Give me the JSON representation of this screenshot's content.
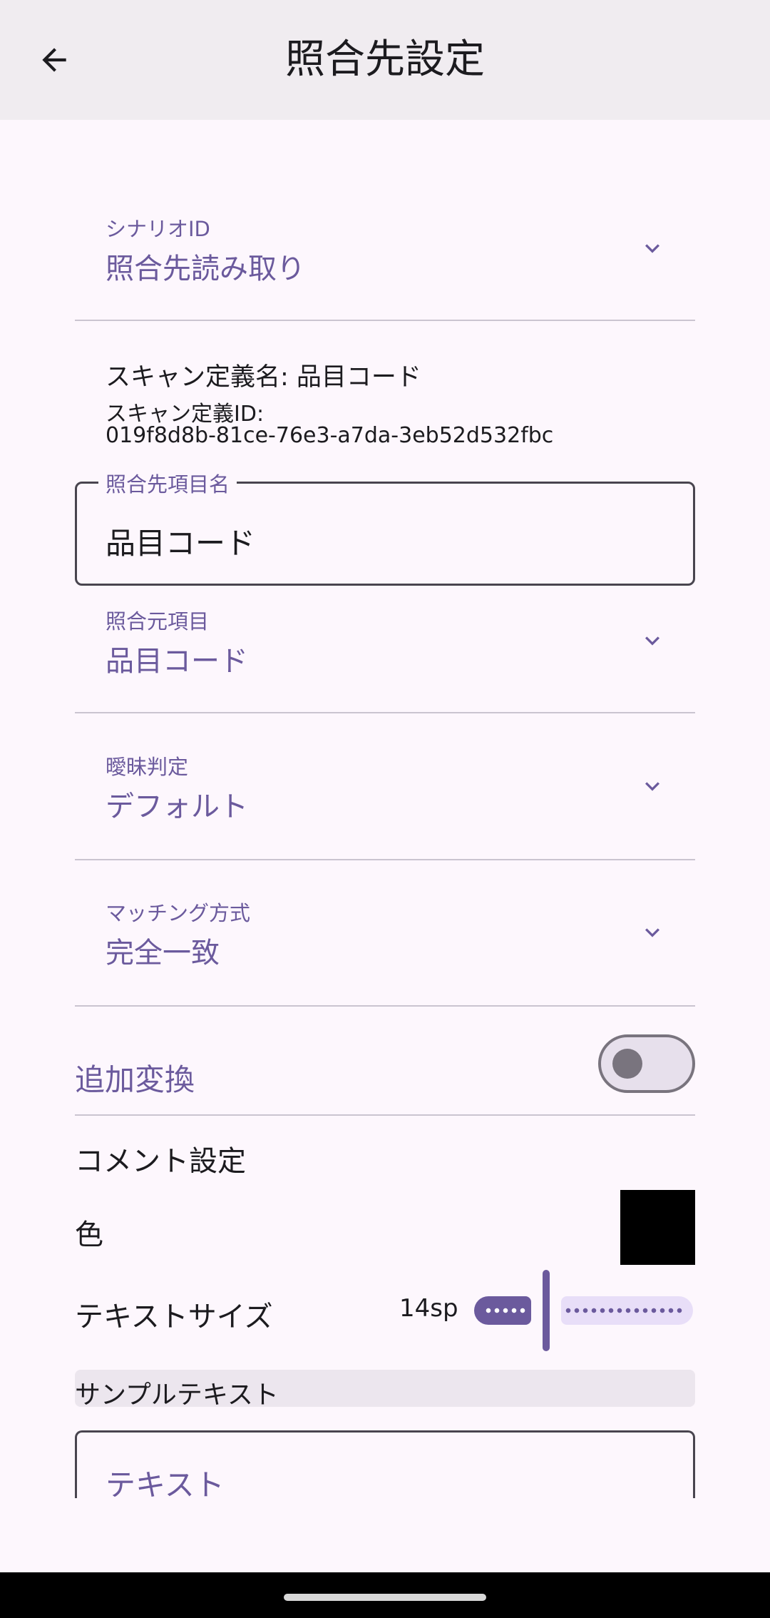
{
  "appbar": {
    "title": "照合先設定"
  },
  "scenario": {
    "label": "シナリオID",
    "value": "照合先読み取り"
  },
  "scan_info": {
    "name_line": "スキャン定義名: 品目コード",
    "id_label": "スキャン定義ID:",
    "id_value": "019f8d8b-81ce-76e3-a7da-3eb52d532fbc"
  },
  "target_item_name": {
    "label": "照合先項目名",
    "value": "品目コード"
  },
  "source_item": {
    "label": "照合元項目",
    "value": "品目コード"
  },
  "fuzzy": {
    "label": "曖昧判定",
    "value": "デフォルト"
  },
  "matching": {
    "label": "マッチング方式",
    "value": "完全一致"
  },
  "extra_conversion": {
    "label": "追加変換",
    "enabled": false
  },
  "comment": {
    "heading": "コメント設定",
    "color_label": "色",
    "color_value": "#000000",
    "text_size_label": "テキストサイズ",
    "text_size_value": "14sp",
    "sample_label": "サンプルテキスト",
    "text_placeholder": "テキスト"
  },
  "colors": {
    "accent": "#6b5a9d",
    "background": "#fdf7fd",
    "appbar": "#f0ecf0"
  }
}
